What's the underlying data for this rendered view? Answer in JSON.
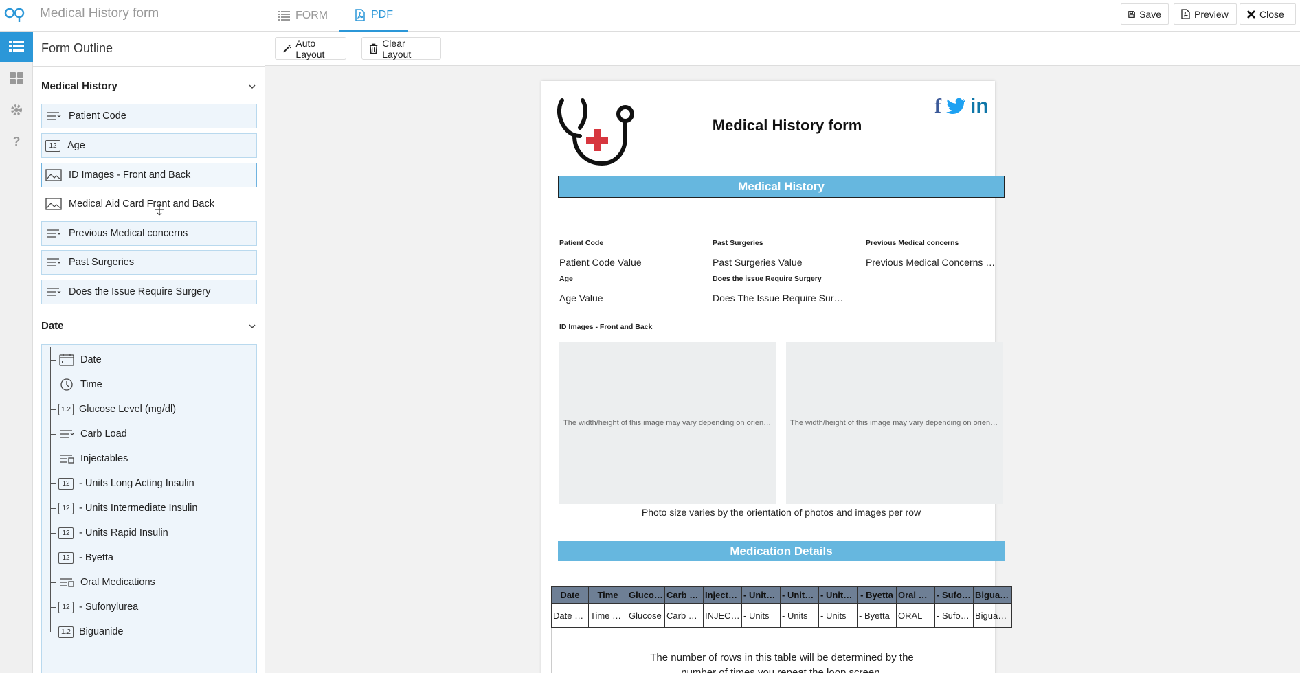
{
  "header": {
    "app_title": "Medical History form",
    "tabs": [
      {
        "label": "FORM"
      },
      {
        "label": "PDF"
      }
    ],
    "actions": {
      "save": "Save",
      "preview": "Preview",
      "close": "Close"
    }
  },
  "outline": {
    "title": "Form Outline",
    "sections": [
      {
        "title": "Medical History",
        "items": [
          {
            "label": "Patient Code",
            "icon": "text-lines-icon"
          },
          {
            "label": "Age",
            "icon": "number-icon"
          },
          {
            "label": "ID Images - Front and Back",
            "icon": "image-icon"
          },
          {
            "label": "Medical Aid Card Front and Back",
            "icon": "image-icon"
          },
          {
            "label": "Previous Medical concerns",
            "icon": "text-lines-icon"
          },
          {
            "label": "Past Surgeries",
            "icon": "text-lines-icon"
          },
          {
            "label": "Does the Issue Require Surgery",
            "icon": "text-lines-icon"
          }
        ]
      },
      {
        "title": "Date",
        "items": [
          {
            "label": "Date",
            "icon": "calendar-icon"
          },
          {
            "label": "Time",
            "icon": "clock-icon"
          },
          {
            "label": "Glucose Level (mg/dl)",
            "icon": "number-icon"
          },
          {
            "label": "Carb Load",
            "icon": "text-lines-icon"
          },
          {
            "label": "Injectables",
            "icon": "choice-list-icon"
          },
          {
            "label": "- Units Long Acting Insulin",
            "icon": "number-icon"
          },
          {
            "label": "- Units Intermediate Insulin",
            "icon": "number-icon"
          },
          {
            "label": "- Units Rapid Insulin",
            "icon": "number-icon"
          },
          {
            "label": "- Byetta",
            "icon": "number-icon"
          },
          {
            "label": "Oral Medications",
            "icon": "choice-list-icon"
          },
          {
            "label": "- Sufonylurea",
            "icon": "number-icon"
          },
          {
            "label": "Biguanide",
            "icon": "number-icon"
          }
        ]
      }
    ],
    "number_icon_text": "1.2",
    "number_icon_text_alt": "12"
  },
  "toolbar": {
    "auto_layout": "Auto Layout",
    "clear_layout": "Clear Layout"
  },
  "pdf": {
    "title": "Medical History form",
    "section1": "Medical History",
    "fields": [
      {
        "label": "Patient Code",
        "value": "Patient Code Value"
      },
      {
        "label": "Past Surgeries",
        "value": "Past Surgeries Value"
      },
      {
        "label": "Previous Medical concerns",
        "value": "Previous Medical Concerns Value"
      },
      {
        "label": "Age",
        "value": "Age Value"
      },
      {
        "label": "Does the issue Require Surgery",
        "value": "Does The Issue Require Surgery Value"
      }
    ],
    "id_images_label": "ID Images - Front and Back",
    "image_placeholder": "The width/height of this image may vary depending on orientation",
    "photo_note": "Photo size varies by the orientation of photos and images per row",
    "section2": "Medication Details",
    "table_headers": [
      "Date",
      "Time",
      "Glucose Level",
      "Carb Load",
      "Injectables",
      "- Units Long",
      "- Units Intermediate",
      "- Units Rapid",
      "- Byetta",
      "Oral Medications",
      "- Sufonylurea",
      "Biguanide"
    ],
    "table_row": [
      "Date Value",
      "Time Value",
      "Glucose",
      "Carb Load",
      "INJECTABLES",
      "- Units",
      "- Units",
      "- Units",
      "- Byetta",
      "ORAL",
      "- Sufonylurea",
      "Biguanide"
    ],
    "loop_note_1": "The number of rows in this table will be determined by the",
    "loop_note_2": "number of times you repeat the loop screen."
  },
  "colors": {
    "accent": "#2b97d8",
    "band": "#66b7df",
    "table_header": "#6e7f95"
  }
}
